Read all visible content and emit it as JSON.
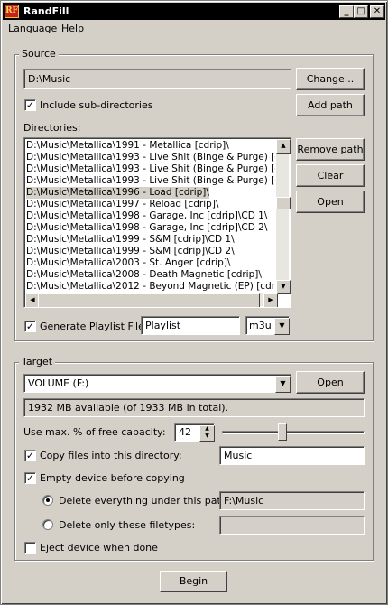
{
  "window": {
    "title": "RandFill",
    "logo": "RF",
    "icons": [
      "logo-icon",
      "minimize-icon",
      "maximize-icon",
      "close-icon"
    ]
  },
  "menu": {
    "items": [
      "Language",
      "Help"
    ]
  },
  "source": {
    "group_label": "Source",
    "path": "D:\\Music",
    "change_label": "Change...",
    "include_sub_label": "Include sub-directories",
    "include_sub_checked": true,
    "add_path_label": "Add path",
    "directories_label": "Directories:",
    "directories": [
      "D:\\Music\\Metallica\\1991 - Metallica [cdrip]\\",
      "D:\\Music\\Metallica\\1993 - Live Shit (Binge & Purge) [cdrip",
      "D:\\Music\\Metallica\\1993 - Live Shit (Binge & Purge) [cdrip",
      "D:\\Music\\Metallica\\1993 - Live Shit (Binge & Purge) [cdrip",
      "D:\\Music\\Metallica\\1996 - Load [cdrip]\\",
      "D:\\Music\\Metallica\\1997 - Reload [cdrip]\\",
      "D:\\Music\\Metallica\\1998 - Garage, Inc [cdrip]\\CD 1\\",
      "D:\\Music\\Metallica\\1998 - Garage, Inc [cdrip]\\CD 2\\",
      "D:\\Music\\Metallica\\1999 - S&M [cdrip]\\CD 1\\",
      "D:\\Music\\Metallica\\1999 - S&M [cdrip]\\CD 2\\",
      "D:\\Music\\Metallica\\2003 - St. Anger [cdrip]\\",
      "D:\\Music\\Metallica\\2008 - Death Magnetic [cdrip]\\",
      "D:\\Music\\Metallica\\2012 - Beyond Magnetic (EP) [cdrip]\\"
    ],
    "selected_index": 4,
    "remove_path_label": "Remove path",
    "clear_label": "Clear",
    "open_label": "Open",
    "playlist_label": "Generate Playlist File",
    "playlist_checked": true,
    "playlist_name": "Playlist",
    "playlist_format": "m3u"
  },
  "target": {
    "group_label": "Target",
    "device": "VOLUME (F:)",
    "open_label": "Open",
    "capacity_text": "1932 MB available (of 1933 MB in total).",
    "max_pct_label": "Use max. % of free capacity:",
    "max_pct_value": "42",
    "max_pct_fraction": 0.42,
    "copy_label": "Copy files into this directory:",
    "copy_checked": true,
    "copy_dir": "Music",
    "empty_label": "Empty device before copying",
    "empty_checked": true,
    "delete_all_label": "Delete everything under this path:",
    "delete_all_selected": true,
    "delete_path": "F:\\Music",
    "delete_types_label": "Delete only these filetypes:",
    "delete_types_value": "",
    "eject_label": "Eject device when done",
    "eject_checked": false
  },
  "begin_label": "Begin"
}
